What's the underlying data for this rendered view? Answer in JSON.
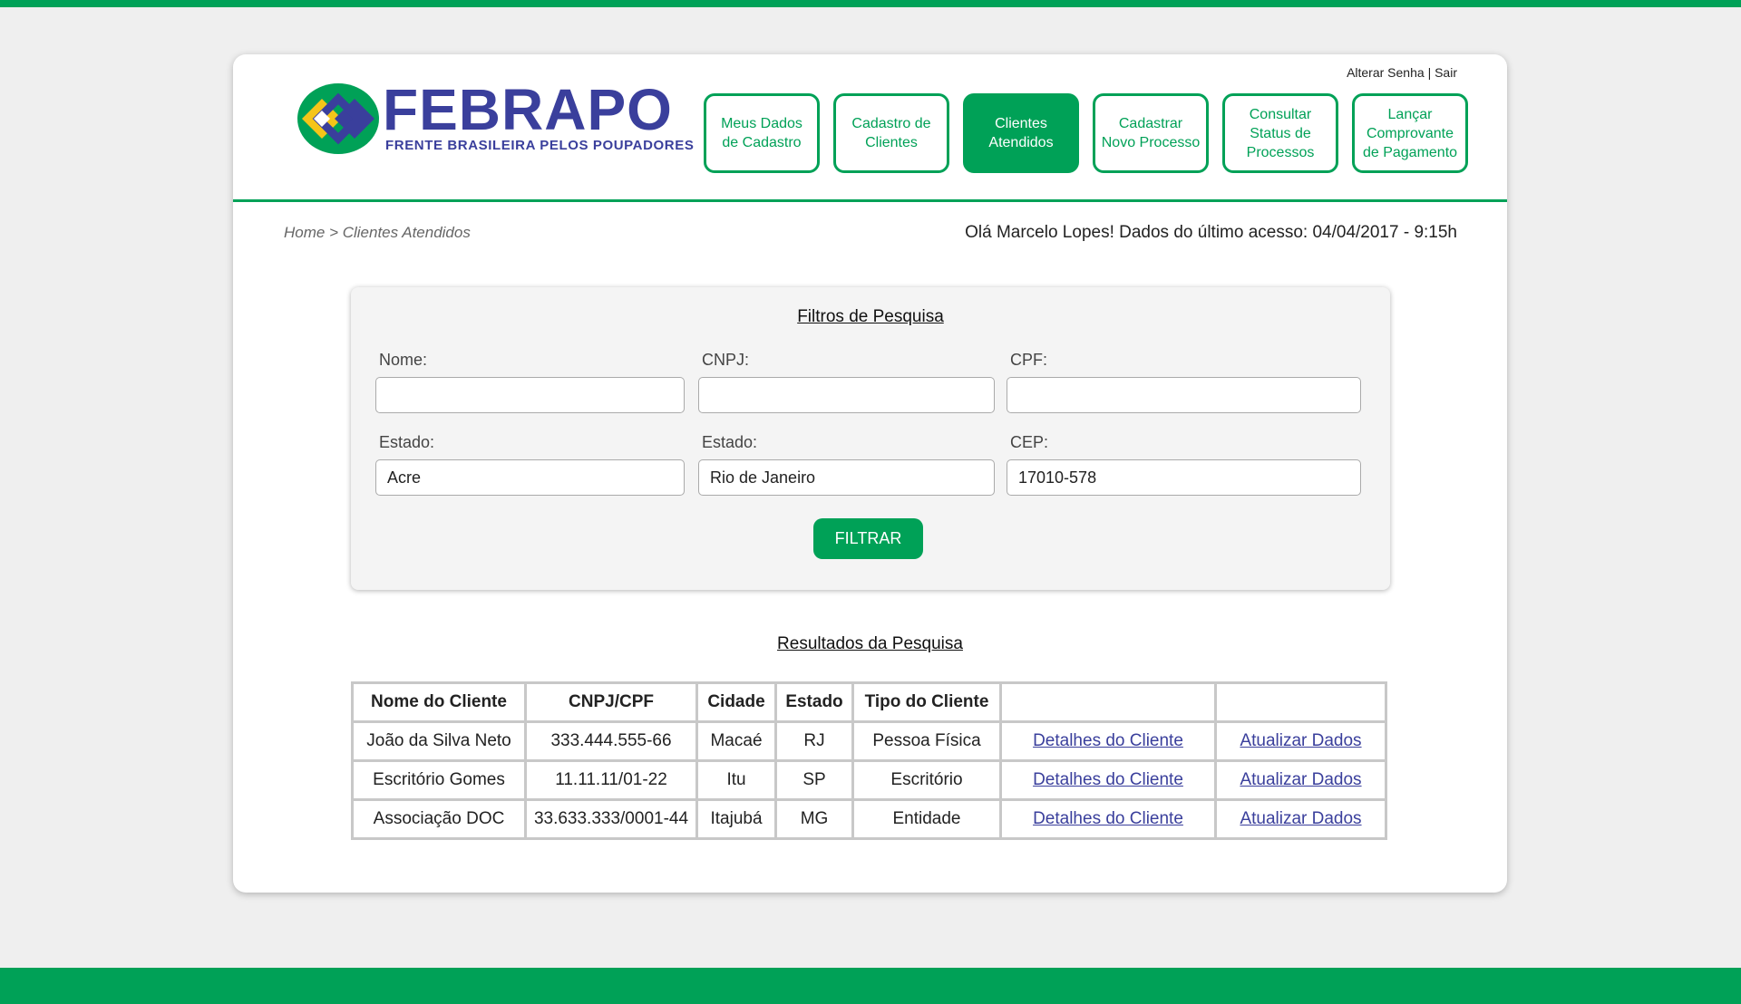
{
  "brand": {
    "name": "FEBRAPO",
    "tagline": "FRENTE BRASILEIRA PELOS POUPADORES",
    "colors": {
      "green": "#00a157",
      "blue": "#3a3f9c",
      "yellow": "#f5c518"
    }
  },
  "user_links": {
    "change_password": "Alterar Senha",
    "separator": "|",
    "logout": "Sair"
  },
  "nav": [
    {
      "label": "Meus Dados de Cadastro",
      "active": false
    },
    {
      "label": "Cadastro de Clientes",
      "active": false
    },
    {
      "label": "Clientes Atendidos",
      "active": true
    },
    {
      "label": "Cadastrar Novo Processo",
      "active": false
    },
    {
      "label": "Consultar Status de Processos",
      "active": false
    },
    {
      "label": "Lançar Comprovante de Pagamento",
      "active": false
    }
  ],
  "breadcrumb": "Home > Clientes Atendidos",
  "greeting": "Olá Marcelo Lopes! Dados do último acesso: 04/04/2017 - 9:15h",
  "filters": {
    "title": "Filtros de Pesquisa",
    "nome": {
      "label": "Nome:",
      "value": ""
    },
    "cnpj": {
      "label": "CNPJ:",
      "value": ""
    },
    "cpf": {
      "label": "CPF:",
      "value": ""
    },
    "estado1": {
      "label": "Estado:",
      "value": "Acre"
    },
    "estado2": {
      "label": "Estado:",
      "value": "Rio de Janeiro"
    },
    "cep": {
      "label": "CEP:",
      "value": "17010-578"
    },
    "button": "FILTRAR"
  },
  "results": {
    "title": "Resultados da Pesquisa",
    "headers": [
      "Nome do Cliente",
      "CNPJ/CPF",
      "Cidade",
      "Estado",
      "Tipo do Cliente",
      "",
      ""
    ],
    "rows": [
      {
        "nome": "João da Silva Neto",
        "doc": "333.444.555-66",
        "cidade": "Macaé",
        "estado": "RJ",
        "tipo": "Pessoa Física",
        "details": "Detalhes do Cliente",
        "update": "Atualizar Dados"
      },
      {
        "nome": "Escritório Gomes",
        "doc": "11.11.11/01-22",
        "cidade": "Itu",
        "estado": "SP",
        "tipo": "Escritório",
        "details": "Detalhes do Cliente",
        "update": "Atualizar Dados"
      },
      {
        "nome": "Associação DOC",
        "doc": "33.633.333/0001-44",
        "cidade": "Itajubá",
        "estado": "MG",
        "tipo": "Entidade",
        "details": "Detalhes do Cliente",
        "update": "Atualizar Dados"
      }
    ]
  }
}
